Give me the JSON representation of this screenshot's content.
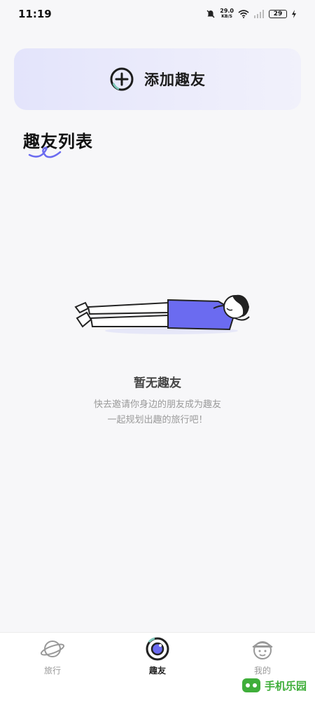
{
  "status_bar": {
    "time": "11:19",
    "net_speed_value": "29.0",
    "net_speed_unit": "KB/S",
    "battery": "29"
  },
  "add_friend": {
    "label": "添加趣友"
  },
  "friend_list": {
    "title": "趣友列表"
  },
  "empty_state": {
    "title": "暂无趣友",
    "line1": "快去邀请你身边的朋友成为趣友",
    "line2": "一起规划出趣的旅行吧！"
  },
  "bottom_nav": {
    "items": [
      {
        "label": "旅行",
        "icon": "planet-icon",
        "active": false
      },
      {
        "label": "趣友",
        "icon": "camera-lens-icon",
        "active": true
      },
      {
        "label": "我的",
        "icon": "face-icon",
        "active": false
      }
    ]
  },
  "watermark": {
    "text": "手机乐园"
  },
  "colors": {
    "accent": "#6b6bf0",
    "card_bg": "#e6e7fb",
    "muted_text": "#9a9a9a"
  }
}
